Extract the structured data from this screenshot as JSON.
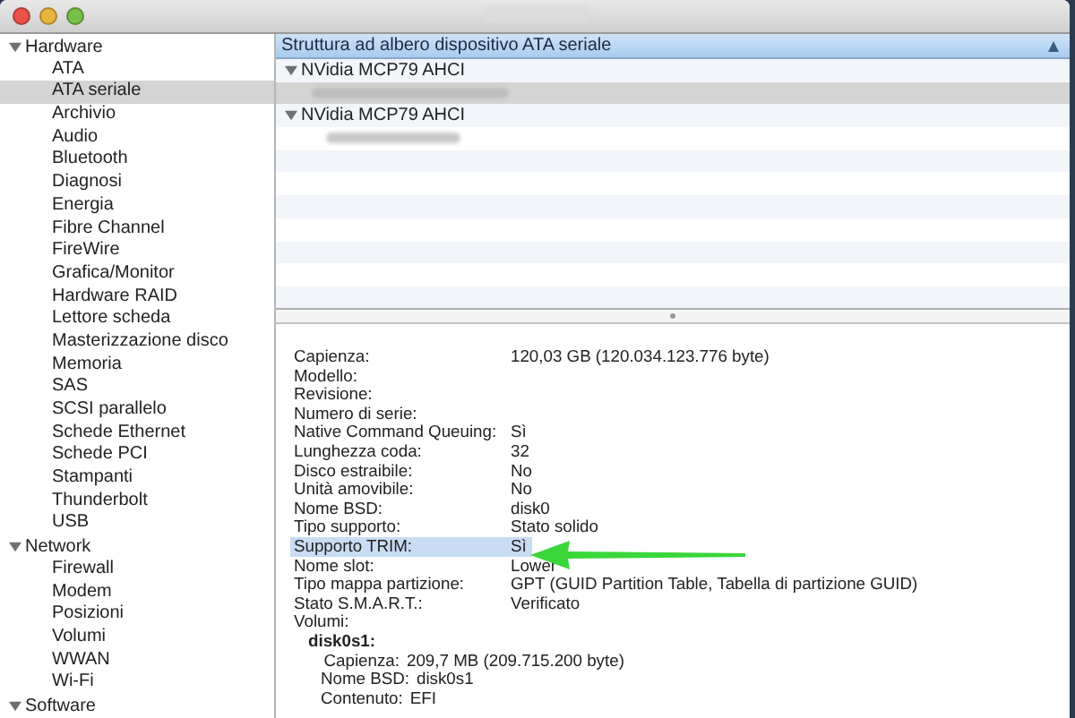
{
  "window": {
    "buttons": [
      {
        "kind": "close"
      },
      {
        "kind": "minimize"
      },
      {
        "kind": "zoom"
      }
    ]
  },
  "sidebar": {
    "groups": [
      {
        "label": "Hardware",
        "expanded": true,
        "items": [
          {
            "label": "ATA",
            "selected": false
          },
          {
            "label": "ATA seriale",
            "selected": true
          },
          {
            "label": "Archivio",
            "selected": false
          },
          {
            "label": "Audio",
            "selected": false
          },
          {
            "label": "Bluetooth",
            "selected": false
          },
          {
            "label": "Diagnosi",
            "selected": false
          },
          {
            "label": "Energia",
            "selected": false
          },
          {
            "label": "Fibre Channel",
            "selected": false
          },
          {
            "label": "FireWire",
            "selected": false
          },
          {
            "label": "Grafica/Monitor",
            "selected": false
          },
          {
            "label": "Hardware RAID",
            "selected": false
          },
          {
            "label": "Lettore scheda",
            "selected": false
          },
          {
            "label": "Masterizzazione disco",
            "selected": false
          },
          {
            "label": "Memoria",
            "selected": false
          },
          {
            "label": "SAS",
            "selected": false
          },
          {
            "label": "SCSI parallelo",
            "selected": false
          },
          {
            "label": "Schede Ethernet",
            "selected": false
          },
          {
            "label": "Schede PCI",
            "selected": false
          },
          {
            "label": "Stampanti",
            "selected": false
          },
          {
            "label": "Thunderbolt",
            "selected": false
          },
          {
            "label": "USB",
            "selected": false
          }
        ]
      },
      {
        "label": "Network",
        "expanded": true,
        "items": [
          {
            "label": "Firewall",
            "selected": false
          },
          {
            "label": "Modem",
            "selected": false
          },
          {
            "label": "Posizioni",
            "selected": false
          },
          {
            "label": "Volumi",
            "selected": false
          },
          {
            "label": "WWAN",
            "selected": false
          },
          {
            "label": "Wi-Fi",
            "selected": false
          }
        ]
      },
      {
        "label": "Software",
        "expanded": true
      }
    ]
  },
  "tree": {
    "header": "Struttura ad albero dispositivo ATA seriale",
    "rows": [
      {
        "label": "NVidia MCP79 AHCI",
        "expanded": true,
        "children": [
          {
            "selected": true
          }
        ]
      },
      {
        "label": "NVidia MCP79 AHCI",
        "expanded": true,
        "children": [
          {
            "selected": false
          }
        ]
      }
    ]
  },
  "details": {
    "rows": [
      {
        "label": "Capienza:",
        "value": "120,03 GB (120.034.123.776 byte)",
        "selected": false
      },
      {
        "label": "Modello:",
        "selected": false
      },
      {
        "label": "Revisione:",
        "selected": false
      },
      {
        "label": "Numero di serie:",
        "selected": false
      },
      {
        "label": "Native Command Queuing:",
        "value": "Sì",
        "selected": false
      },
      {
        "label": "Lunghezza coda:",
        "value": "32",
        "selected": false
      },
      {
        "label": "Disco estraibile:",
        "value": "No",
        "selected": false
      },
      {
        "label": "Unità amovibile:",
        "value": "No",
        "selected": false
      },
      {
        "label": "Nome BSD:",
        "value": "disk0",
        "selected": false
      },
      {
        "label": "Tipo supporto:",
        "value": "Stato solido",
        "selected": false
      },
      {
        "label": "Supporto TRIM:",
        "value": "Sì",
        "selected": true
      },
      {
        "label": "Nome slot:",
        "value": "Lower",
        "selected": false
      },
      {
        "label": "Tipo mappa partizione:",
        "value": "GPT (GUID Partition Table, Tabella di partizione GUID)",
        "selected": false
      },
      {
        "label": "Stato S.M.A.R.T.:",
        "value": "Verificato",
        "selected": false
      }
    ],
    "volumes_label": "Volumi:",
    "volumes": [
      {
        "name": "disk0s1:",
        "rows": [
          {
            "label": "Capienza:",
            "value": "209,7 MB (209.715.200 byte)"
          },
          {
            "label": "Nome BSD:",
            "value": "disk0s1"
          },
          {
            "label": "Contenuto:",
            "value": "EFI"
          }
        ]
      }
    ]
  }
}
